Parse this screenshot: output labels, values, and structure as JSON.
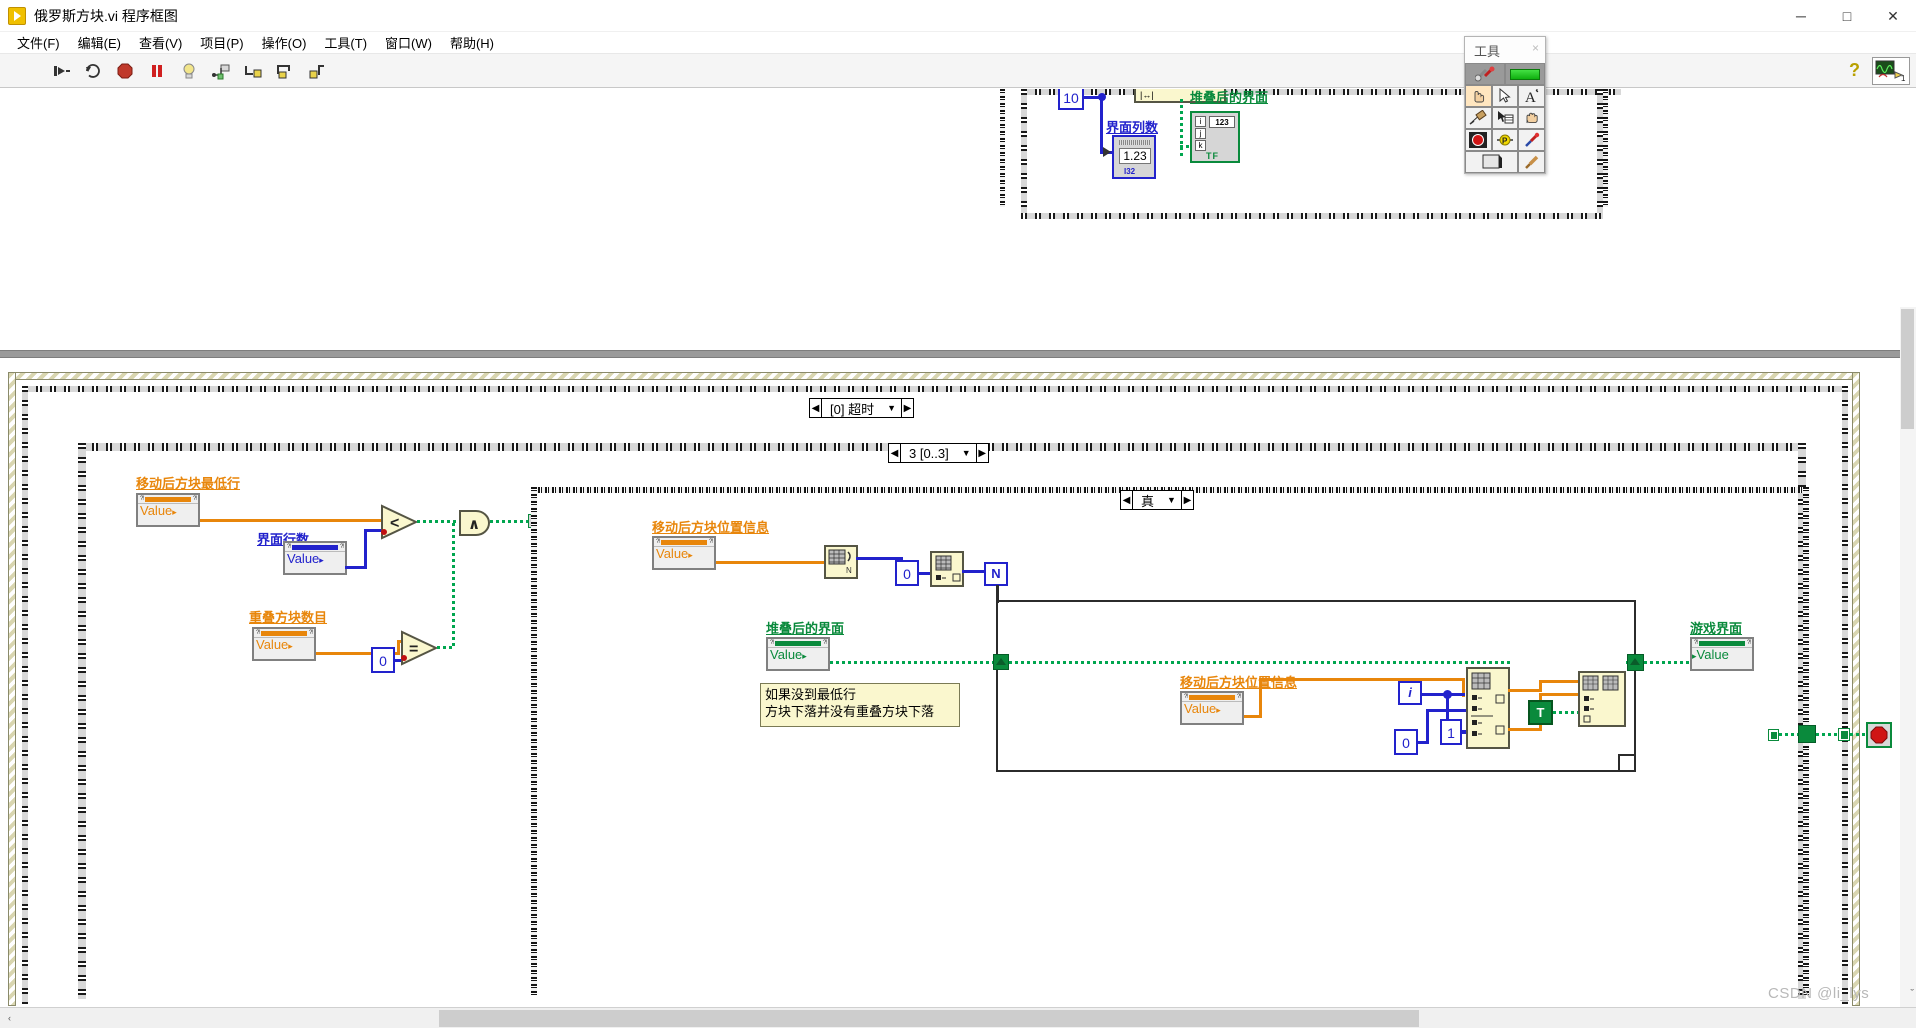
{
  "window": {
    "title": "俄罗斯方块.vi 程序框图",
    "app_icon": "labview-run-icon",
    "minimize": "─",
    "maximize": "□",
    "close": "✕"
  },
  "menubar": {
    "items": [
      {
        "label": "文件(F)",
        "name": "menu-file"
      },
      {
        "label": "编辑(E)",
        "name": "menu-edit"
      },
      {
        "label": "查看(V)",
        "name": "menu-view"
      },
      {
        "label": "项目(P)",
        "name": "menu-project"
      },
      {
        "label": "操作(O)",
        "name": "menu-operate"
      },
      {
        "label": "工具(T)",
        "name": "menu-tools"
      },
      {
        "label": "窗口(W)",
        "name": "menu-window"
      },
      {
        "label": "帮助(H)",
        "name": "menu-help"
      }
    ]
  },
  "toolbar": {
    "buttons": [
      {
        "name": "run-button",
        "glyph": "⮞"
      },
      {
        "name": "run-continuously-button",
        "glyph": "⟳"
      },
      {
        "name": "abort-execution-button",
        "glyph": "⬣"
      },
      {
        "name": "pause-button",
        "glyph": "‖"
      },
      {
        "name": "highlight-execution-button",
        "glyph": "☀"
      },
      {
        "name": "retain-wire-values-button",
        "glyph": "⌗"
      },
      {
        "name": "step-into-button",
        "glyph": "↳"
      },
      {
        "name": "step-over-button",
        "glyph": "↷"
      },
      {
        "name": "step-out-button",
        "glyph": "↱"
      }
    ],
    "help_glyph": "?",
    "context_help_icon": "waveform-graph-icon",
    "context_help_badge": "1"
  },
  "tools_palette": {
    "title": "工具",
    "close_glyph": "×",
    "auto_tool_selected": true,
    "rows": [
      [
        {
          "name": "automatic-tool-selection-icon",
          "glyph": "⚒"
        },
        {
          "name": "auto-tool-indicator",
          "glyph": ""
        }
      ],
      [
        {
          "name": "operate-value-hand-icon",
          "glyph": "☝"
        },
        {
          "name": "position-size-select-icon",
          "glyph": "➤"
        },
        {
          "name": "edit-text-icon",
          "glyph": "A"
        }
      ],
      [
        {
          "name": "connect-wire-spool-icon",
          "glyph": "⧉"
        },
        {
          "name": "object-shortcut-menu-icon",
          "glyph": "☰"
        },
        {
          "name": "scroll-window-hand-icon",
          "glyph": "✋"
        }
      ],
      [
        {
          "name": "set-clear-breakpoint-icon",
          "glyph": "⬤"
        },
        {
          "name": "probe-data-icon",
          "glyph": "P"
        },
        {
          "name": "get-color-dropper-icon",
          "glyph": "✒"
        }
      ],
      [
        {
          "name": "set-color-icon",
          "glyph": "▧"
        },
        {
          "name": "paint-brush-icon",
          "glyph": "✎"
        }
      ]
    ]
  },
  "diagram": {
    "event_case_selector": {
      "name": "event-structure-case-selector",
      "value": "[0] 超时",
      "left_arrow": "◀",
      "right_arrow": "▶",
      "down_arrow": "▼"
    },
    "sequence_frame_selector": {
      "name": "flat-sequence-frame-selector",
      "value": "3 [0..3]",
      "left_arrow": "◀",
      "right_arrow": "▶",
      "down_arrow": "▼"
    },
    "case_selector_true": {
      "name": "case-structure-selector",
      "value": "真",
      "left_arrow": "◀",
      "right_arrow": "▶",
      "down_arrow": "▼"
    },
    "top_region": {
      "constant_10": "10",
      "label_interface_columns": "界面列数",
      "ctrl_interface_columns_value": "1.23",
      "ctrl_interface_columns_type": "I32",
      "label_stacked_interface": "堆叠后的界面",
      "cluster_rows": [
        "i",
        "j",
        "k"
      ],
      "cluster_numeric": "123",
      "cluster_bool": "TF"
    },
    "property_nodes": [
      {
        "name": "prop-node-lowest-row-after-move",
        "label": "移动后方块最低行",
        "value_text": "Value",
        "color": "#E8860B"
      },
      {
        "name": "prop-node-interface-rows",
        "label": "界面行数",
        "value_text": "Value",
        "color": "#2222CC"
      },
      {
        "name": "prop-node-overlap-block-count",
        "label": "重叠方块数目",
        "value_text": "Value",
        "color": "#E8860B"
      },
      {
        "name": "prop-node-block-position-info-1",
        "label": "移动后方块位置信息",
        "value_text": "Value",
        "color": "#E8860B"
      },
      {
        "name": "prop-node-stacked-interface",
        "label": "堆叠后的界面",
        "value_text": "Value",
        "color": "#0A8A3C"
      },
      {
        "name": "prop-node-block-position-info-2",
        "label": "移动后方块位置信息",
        "value_text": "Value",
        "color": "#E8860B"
      },
      {
        "name": "prop-node-game-interface",
        "label": "游戏界面",
        "value_text": "Value",
        "color": "#0A8A3C"
      }
    ],
    "functions": {
      "less_than": {
        "name": "less-than-function",
        "glyph": "<"
      },
      "equal_to": {
        "name": "equal-to-function",
        "glyph": "="
      },
      "and_gate": {
        "name": "and-function",
        "glyph": "∧"
      },
      "array_size": {
        "name": "array-size-function"
      },
      "index_array_1": {
        "name": "index-array-function"
      },
      "index_array_2": {
        "name": "index-array-function"
      },
      "replace_array_subset": {
        "name": "replace-array-subset-function"
      },
      "true_constant": {
        "name": "true-constant",
        "glyph": "T"
      }
    },
    "constants": {
      "zero_a": "0",
      "zero_b": "0",
      "zero_c": "0",
      "one": "1",
      "loop_index_i": "i",
      "loop_count_n": "N"
    },
    "comment": {
      "name": "diagram-comment",
      "text": "如果没到最低行\n方块下落并没有重叠方块下落"
    },
    "stop_button": {
      "name": "stop-button-terminal",
      "glyph": "⬣"
    }
  },
  "scrollbars": {
    "h_left_arrow": "‹",
    "h_right_arrow": "›",
    "v_down_arrow": "ˇ"
  },
  "watermark": "CSDN @li_lys"
}
